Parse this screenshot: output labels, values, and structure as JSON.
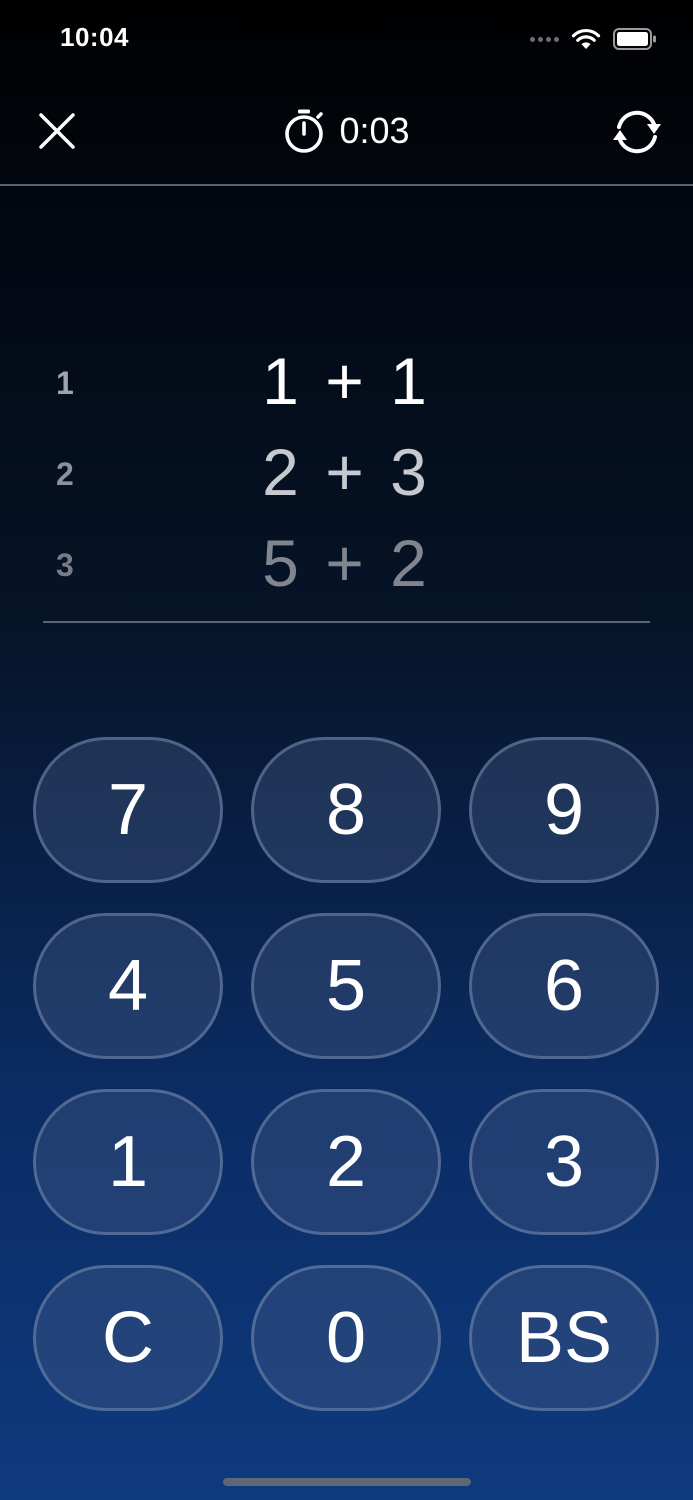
{
  "status_bar": {
    "time": "10:04"
  },
  "nav": {
    "timer": "0:03"
  },
  "problems": [
    {
      "index": "1",
      "expression": "1 + 1"
    },
    {
      "index": "2",
      "expression": "2 + 3"
    },
    {
      "index": "3",
      "expression": "5 + 2"
    }
  ],
  "keypad": {
    "keys": [
      "7",
      "8",
      "9",
      "4",
      "5",
      "6",
      "1",
      "2",
      "3",
      "C",
      "0",
      "BS"
    ]
  },
  "colors": {
    "background_top": "#000000",
    "background_bottom": "#0e3a7e",
    "key_fill": "#2a3d63",
    "key_border": "#6b7fa3"
  }
}
